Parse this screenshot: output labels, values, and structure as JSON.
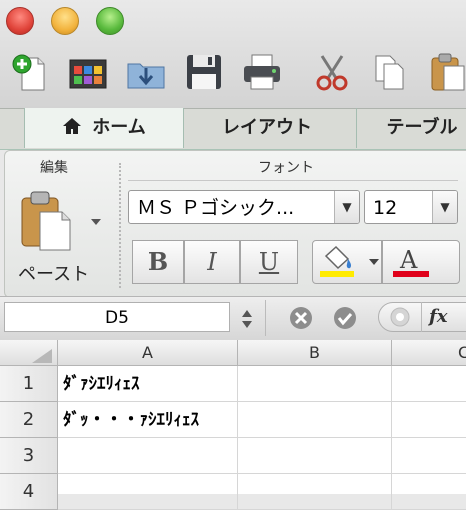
{
  "ribbon": {
    "tabs": [
      "ホーム",
      "レイアウト",
      "テーブル"
    ],
    "groups": {
      "edit": "編集",
      "font": "フォント"
    },
    "paste_label": "ペースト",
    "font_name": "ＭＳ Ｐゴシック...",
    "font_size": "12",
    "bold": "B",
    "italic": "I",
    "underline": "U",
    "fill_color": "#ffeb00",
    "font_color": "#e0001a"
  },
  "formula_bar": {
    "name_box": "D5",
    "fx": "fx"
  },
  "sheet": {
    "columns": [
      "A",
      "B",
      "C"
    ],
    "rows": [
      {
        "num": "1",
        "a": "ﾀﾞｧｼｴﾘｨｪｽ"
      },
      {
        "num": "2",
        "a": "ﾀﾞｯ・・・ｧｼｴﾘｨｪｽ"
      },
      {
        "num": "3",
        "a": ""
      },
      {
        "num": "4",
        "a": ""
      }
    ]
  }
}
